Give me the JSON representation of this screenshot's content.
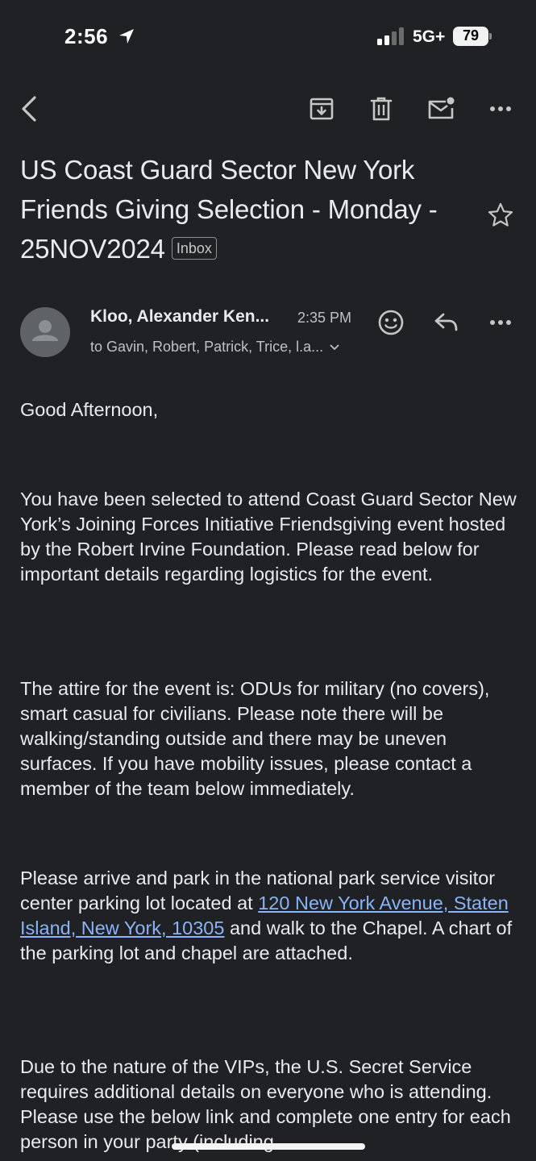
{
  "status_bar": {
    "time": "2:56",
    "network": "5G+",
    "battery": "79"
  },
  "email": {
    "subject": "US Coast Guard Sector New York Friends Giving Selection - Monday - 25NOV2024",
    "label": "Inbox",
    "sender": "Kloo, Alexander Ken...",
    "time": "2:35 PM",
    "recipients": "to Gavin, Robert, Patrick, Trice, l.a..."
  },
  "body": {
    "greeting": "Good Afternoon,",
    "p1": "You have been selected to attend Coast Guard Sector New York’s Joining Forces Initiative Friendsgiving event hosted by the Robert Irvine Foundation. Please read below for important details regarding logistics for the event.",
    "p2": "The attire for the event is: ODUs for military (no covers), smart casual for civilians. Please note there will be walking/standing outside and there may be uneven surfaces. If you have mobility issues, please contact a member of the team below immediately.",
    "p3_before": "Please arrive and park in the national park service visitor center parking lot located at ",
    "p3_link": "120 New York Avenue, Staten Island, New York, 10305",
    "p3_after": " and walk to the Chapel. A chart of the parking lot and chapel are attached.",
    "p4": "Due to the nature of the VIPs, the U.S. Secret Service requires additional details on everyone who is attending. Please use the below link and complete one entry for each person in your party (including"
  }
}
